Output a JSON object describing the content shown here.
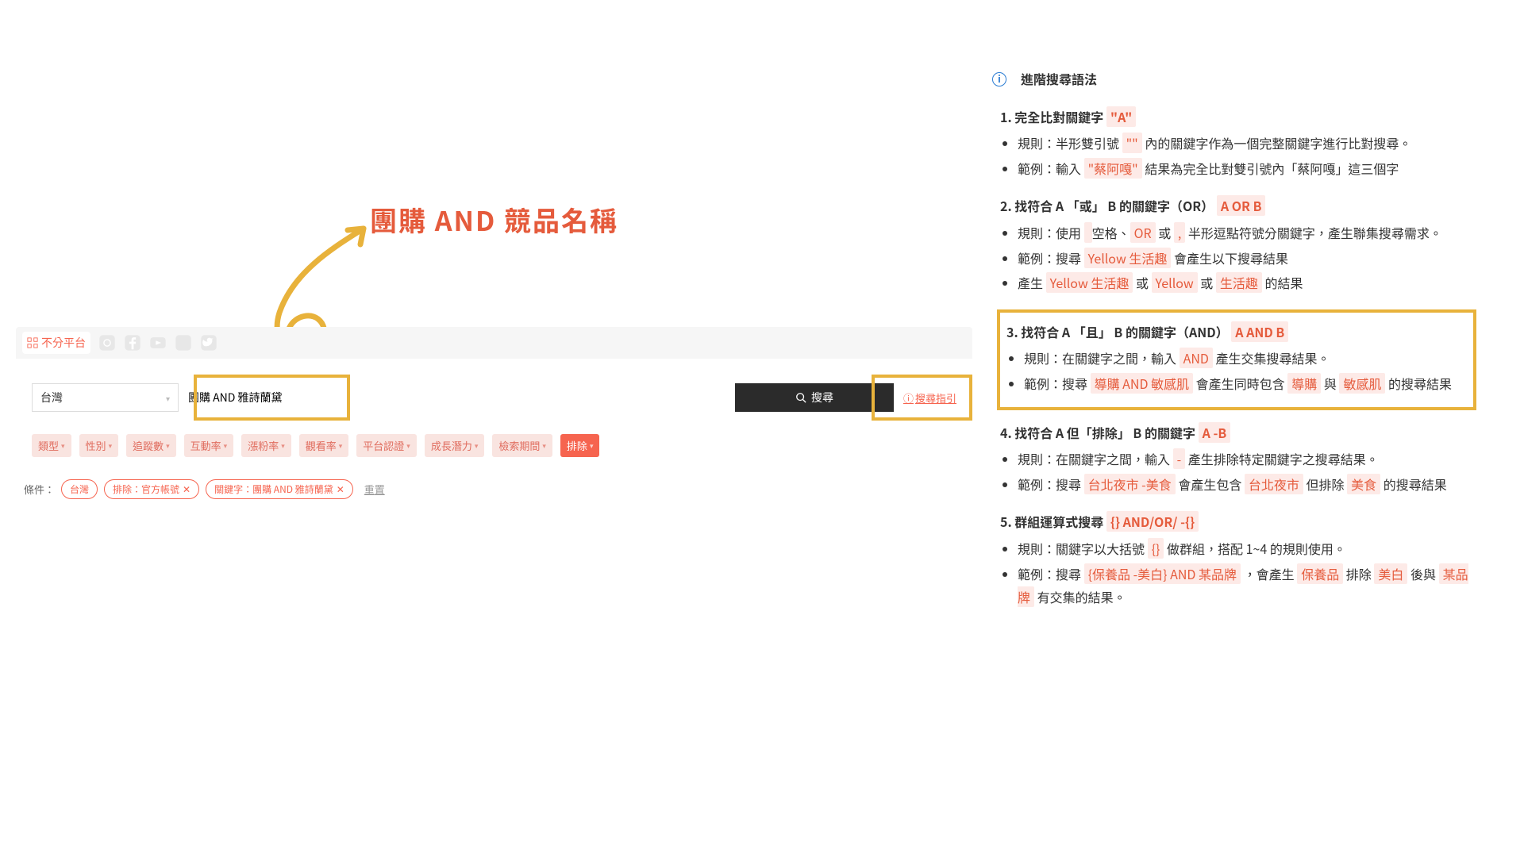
{
  "annotation": "團購 AND 競品名稱",
  "platform_bar": {
    "all": "不分平台"
  },
  "search": {
    "country": "台灣",
    "query": "團購 AND 雅詩蘭黛",
    "button": "搜尋",
    "guide": "搜尋指引"
  },
  "filters": [
    "類型",
    "性別",
    "追蹤數",
    "互動率",
    "漲粉率",
    "觀看率",
    "平台認證",
    "成長潛力",
    "檢索期間"
  ],
  "exclude_label": "排除",
  "conditions": {
    "label": "條件：",
    "tags": [
      "台灣",
      "排除：官方帳號",
      "關鍵字：團購 AND 雅詩蘭黛"
    ],
    "reset": "重置"
  },
  "panel": {
    "title": "進階搜尋語法",
    "rules": [
      {
        "title_pre": "1. 完全比對關鍵字 ",
        "title_code": "\"A\"",
        "bullets": [
          {
            "parts": [
              "規則：半形雙引號 ",
              {
                "hl": "\"\""
              },
              " 內的關鍵字作為一個完整關鍵字進行比對搜尋。"
            ]
          },
          {
            "parts": [
              "範例：輸入 ",
              {
                "hl": "\"蔡阿嘎\""
              },
              " 結果為完全比對雙引號內「蔡阿嘎」這三個字"
            ]
          }
        ]
      },
      {
        "title_pre": "2. 找符合 A 「或」 B 的關鍵字（OR） ",
        "title_code": "A OR B",
        "bullets": [
          {
            "parts": [
              "規則：使用 ",
              {
                "hl": " "
              },
              " 空格、",
              {
                "hl": "OR"
              },
              " 或 ",
              {
                "hl": ","
              },
              " 半形逗點符號分關鍵字，產生聯集搜尋需求。"
            ]
          },
          {
            "parts": [
              "範例：搜尋 ",
              {
                "hl": "Yellow 生活趣"
              },
              " 會產生以下搜尋結果"
            ]
          },
          {
            "parts": [
              "產生 ",
              {
                "hl": "Yellow 生活趣"
              },
              " 或 ",
              {
                "hl": "Yellow"
              },
              " 或 ",
              {
                "hl": "生活趣"
              },
              " 的結果"
            ]
          }
        ]
      },
      {
        "title_pre": "3. 找符合 A 「且」 B 的關鍵字（AND） ",
        "title_code": "A AND B",
        "highlight": true,
        "bullets": [
          {
            "parts": [
              "規則：在關鍵字之間，輸入 ",
              {
                "hl": "AND"
              },
              " 產生交集搜尋結果。"
            ]
          },
          {
            "parts": [
              "範例：搜尋 ",
              {
                "hl": "導購 AND 敏感肌"
              },
              " 會產生同時包含 ",
              {
                "hl": "導購"
              },
              " 與 ",
              {
                "hl": "敏感肌"
              },
              " 的搜尋結果"
            ]
          }
        ]
      },
      {
        "title_pre": "4. 找符合 A 但「排除」 B 的關鍵字 ",
        "title_code": "A -B",
        "bullets": [
          {
            "parts": [
              "規則：在關鍵字之間，輸入 ",
              {
                "hl": "-"
              },
              " 產生排除特定關鍵字之搜尋結果。"
            ]
          },
          {
            "parts": [
              "範例：搜尋 ",
              {
                "hl": "台北夜市 -美食"
              },
              " 會產生包含 ",
              {
                "hl": "台北夜市"
              },
              " 但排除 ",
              {
                "hl": "美食"
              },
              " 的搜尋結果"
            ]
          }
        ]
      },
      {
        "title_pre": "5. 群組運算式搜尋 ",
        "title_code": "{} AND/OR/ -{}",
        "bullets": [
          {
            "parts": [
              "規則：關鍵字以大括號 ",
              {
                "hl": "{}"
              },
              " 做群組，搭配 1~4 的規則使用。"
            ]
          },
          {
            "parts": [
              "範例：搜尋 ",
              {
                "hl": "{保養品 -美白} AND 某品牌"
              },
              " ，會產生 ",
              {
                "hl": "保養品"
              },
              " 排除 ",
              {
                "hl": "美白"
              },
              " 後與 ",
              {
                "hl": "某品牌"
              },
              " 有交集的結果。"
            ]
          }
        ]
      }
    ]
  }
}
